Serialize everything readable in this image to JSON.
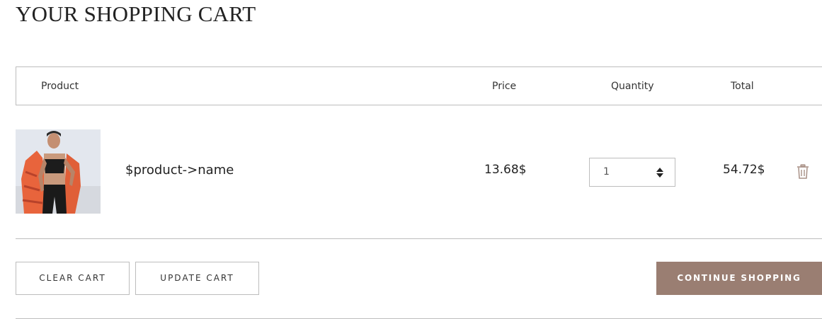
{
  "page": {
    "title": "YOUR SHOPPING CART"
  },
  "table": {
    "headers": {
      "product": "Product",
      "price": "Price",
      "quantity": "Quantity",
      "total": "Total"
    },
    "rows": [
      {
        "image_icon": "product-photo",
        "name": "$product->name",
        "price": "13.68$",
        "quantity": "1",
        "total": "54.72$",
        "remove_icon": "trash-icon"
      }
    ]
  },
  "actions": {
    "clear_cart": "CLEAR CART",
    "update_cart": "UPDATE CART",
    "continue_shopping": "CONTINUE SHOPPING"
  },
  "colors": {
    "accent": "#9a7e72",
    "border": "#bdbdbd",
    "trash_icon": "#a89086"
  }
}
